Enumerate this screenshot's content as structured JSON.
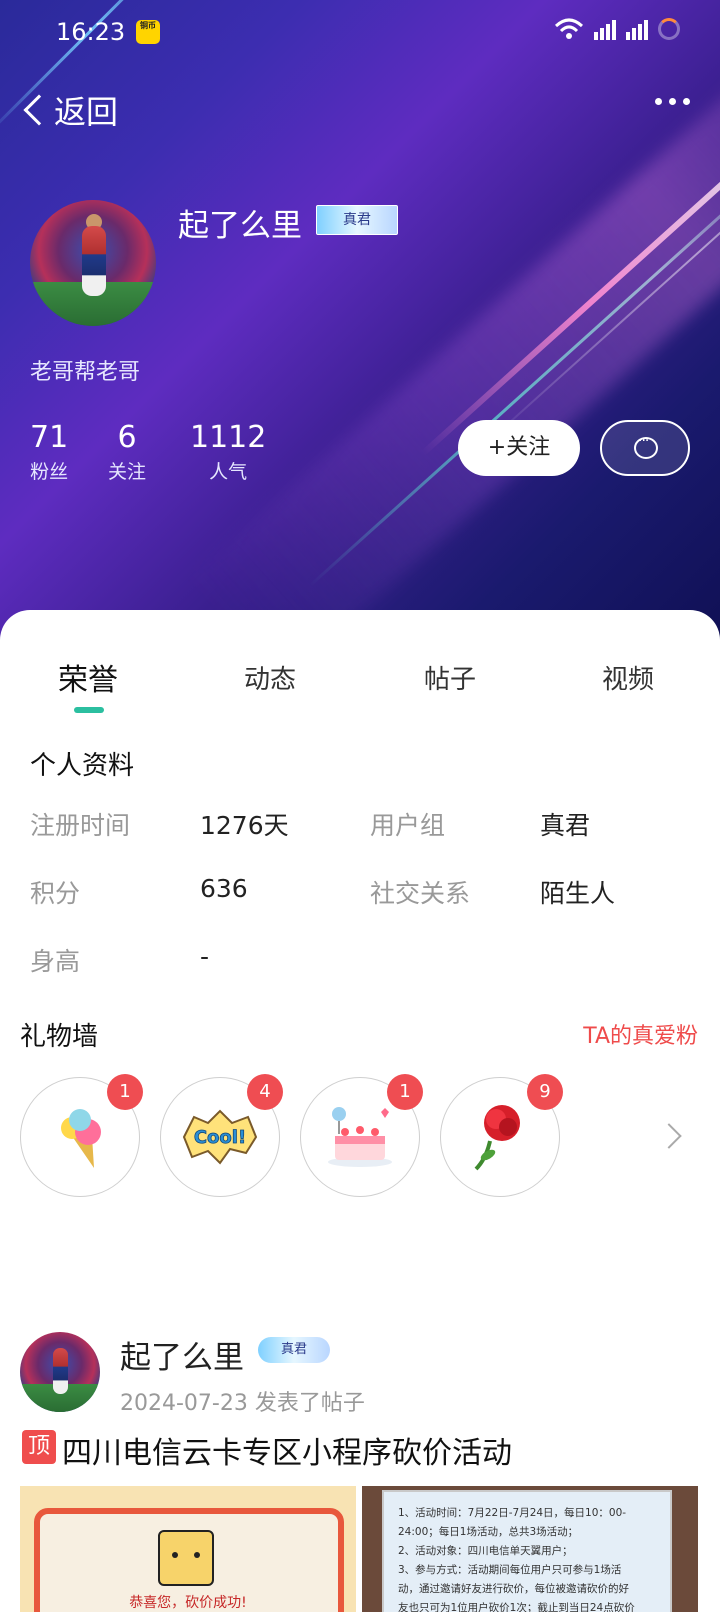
{
  "statusbar": {
    "time": "16:23",
    "notif_label": "铜币"
  },
  "nav": {
    "back_label": "返回"
  },
  "profile": {
    "name": "起了么里",
    "badge": "真君",
    "signature": "老哥帮老哥",
    "stats": [
      {
        "num": "71",
        "label": "粉丝"
      },
      {
        "num": "6",
        "label": "关注"
      },
      {
        "num": "1112",
        "label": "人气"
      }
    ],
    "follow_label": "+关注"
  },
  "tabs": [
    {
      "label": "荣誉",
      "active": true
    },
    {
      "label": "动态",
      "active": false
    },
    {
      "label": "帖子",
      "active": false
    },
    {
      "label": "视频",
      "active": false
    }
  ],
  "info": {
    "title": "个人资料",
    "rows": [
      {
        "label": "注册时间",
        "value": "1276天"
      },
      {
        "label": "用户组",
        "value": "真君"
      },
      {
        "label": "积分",
        "value": "636"
      },
      {
        "label": "社交关系",
        "value": "陌生人"
      },
      {
        "label": "身高",
        "value": "-"
      }
    ]
  },
  "gifts": {
    "title": "礼物墙",
    "link": "TA的真爱粉",
    "items": [
      {
        "icon": "ice-cream-icon",
        "count": "1"
      },
      {
        "icon": "cool-sticker-icon",
        "count": "4"
      },
      {
        "icon": "cake-icon",
        "count": "1"
      },
      {
        "icon": "rose-icon",
        "count": "9"
      }
    ]
  },
  "post": {
    "author": "起了么里",
    "badge": "真君",
    "meta": "2024-07-23 发表了帖子",
    "pin": "顶",
    "title": "四川电信云卡专区小程序砍价活动",
    "image1_caption": "恭喜您，砍价成功!",
    "image2_lines": [
      "1、活动时间：7月22日-7月24日，每日10：00-",
      "24:00；每日1场活动，总共3场活动；",
      "2、活动对象：四川电信单天翼用户；",
      "3、参与方式：活动期间每位用户只可参与1场活",
      "动，通过邀请好友进行砍价，每位被邀请砍价的好",
      "友也只可为1位用户砍价1次；截止到当日24点砍价"
    ]
  }
}
